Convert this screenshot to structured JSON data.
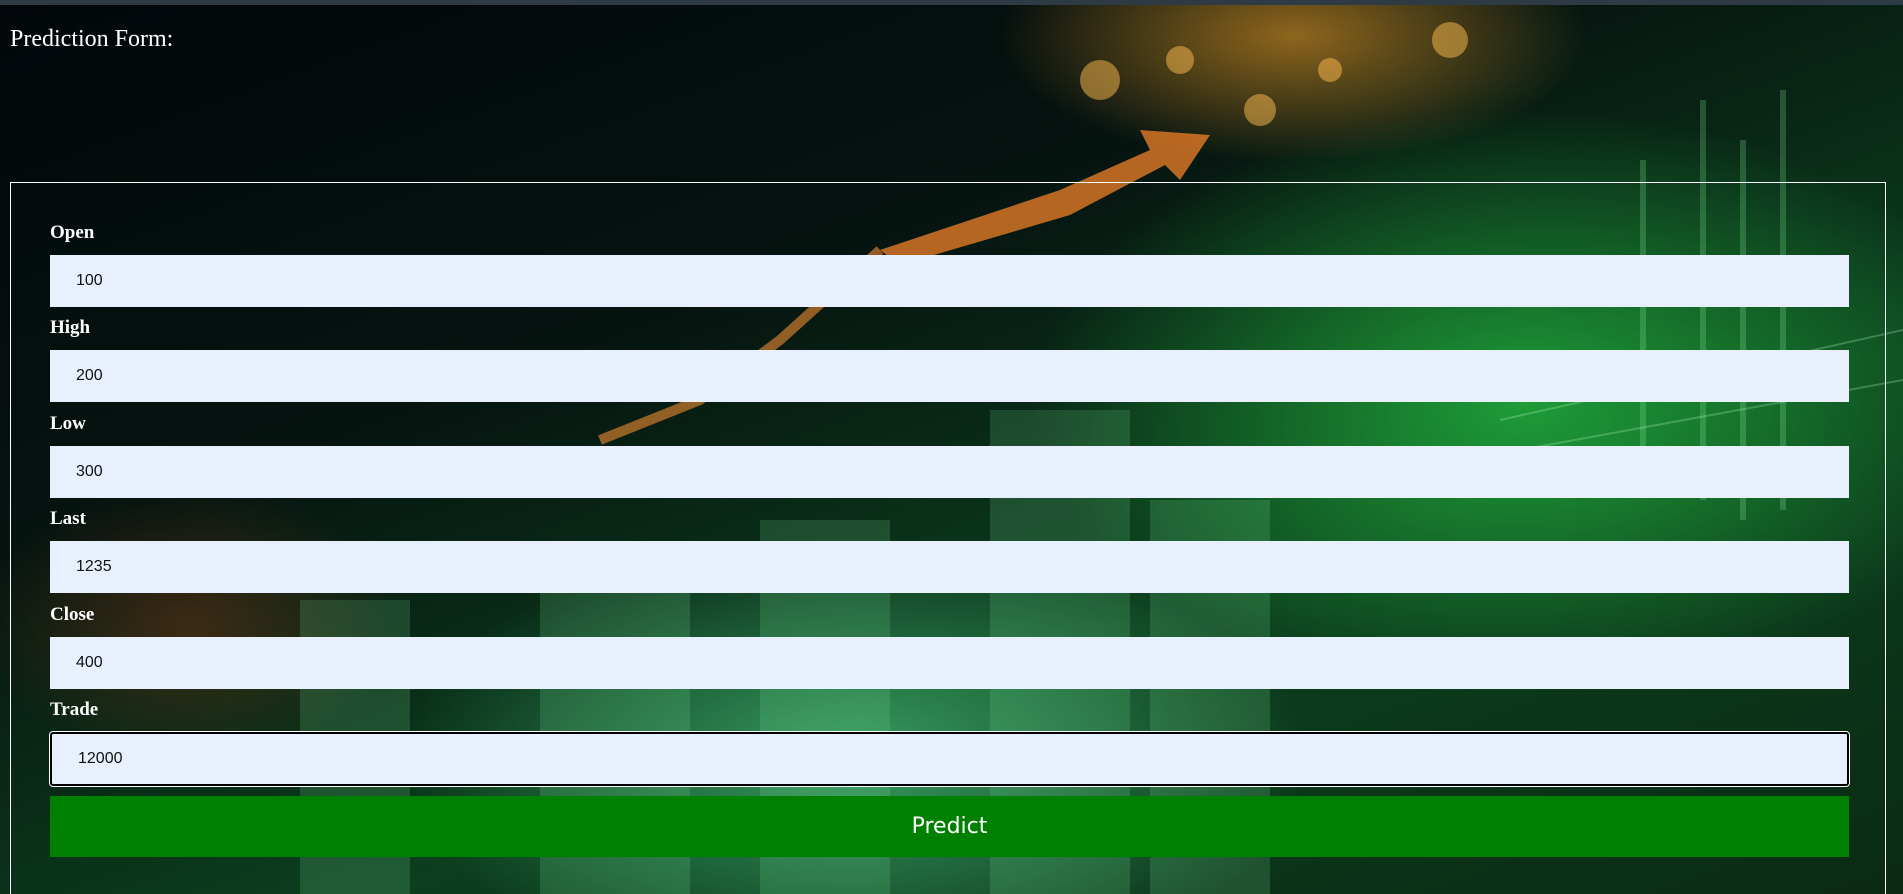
{
  "page": {
    "title": "Prediction Form:"
  },
  "form": {
    "fields": [
      {
        "label": "Open",
        "value": "100"
      },
      {
        "label": "High",
        "value": "200"
      },
      {
        "label": "Low",
        "value": "300"
      },
      {
        "label": "Last",
        "value": "1235"
      },
      {
        "label": "Close",
        "value": "400"
      },
      {
        "label": "Trade",
        "value": "12000"
      }
    ],
    "submit_label": "Predict"
  },
  "colors": {
    "button_bg": "#008000",
    "input_bg": "#e8f0fe",
    "text": "#ffffff"
  }
}
